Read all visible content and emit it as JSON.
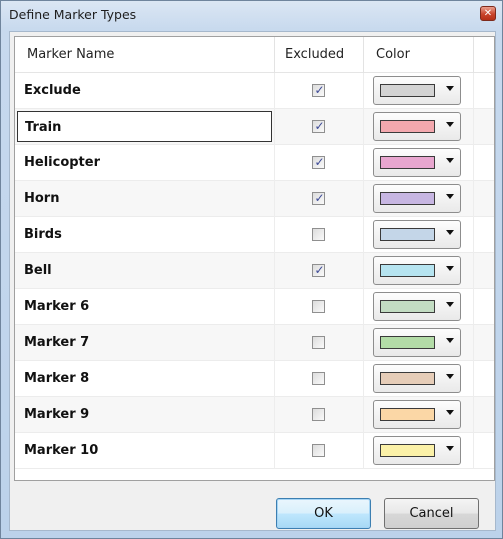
{
  "window": {
    "title": "Define Marker Types",
    "close_icon": "close-icon"
  },
  "grid": {
    "columns": [
      "Marker Name",
      "Excluded",
      "Color"
    ],
    "rows": [
      {
        "name": "Exclude",
        "excluded": true,
        "color": "#d3d3d3"
      },
      {
        "name": "Train",
        "excluded": true,
        "color": "#f3a8ae"
      },
      {
        "name": "Helicopter",
        "excluded": true,
        "color": "#e8a6cf"
      },
      {
        "name": "Horn",
        "excluded": true,
        "color": "#c7b6e2"
      },
      {
        "name": "Birds",
        "excluded": false,
        "color": "#c4d6e8"
      },
      {
        "name": "Bell",
        "excluded": true,
        "color": "#b6e4f0"
      },
      {
        "name": "Marker 6",
        "excluded": false,
        "color": "#c2dcc2"
      },
      {
        "name": "Marker 7",
        "excluded": false,
        "color": "#b3dca7"
      },
      {
        "name": "Marker 8",
        "excluded": false,
        "color": "#e6cdb8"
      },
      {
        "name": "Marker 9",
        "excluded": false,
        "color": "#fbd7a6"
      },
      {
        "name": "Marker 10",
        "excluded": false,
        "color": "#fbf1a8"
      }
    ],
    "focused_row": 1
  },
  "buttons": {
    "ok": "OK",
    "cancel": "Cancel"
  },
  "colors": {
    "checkmark": "#3d4a96",
    "default_button_border": "#3c7fb1"
  }
}
